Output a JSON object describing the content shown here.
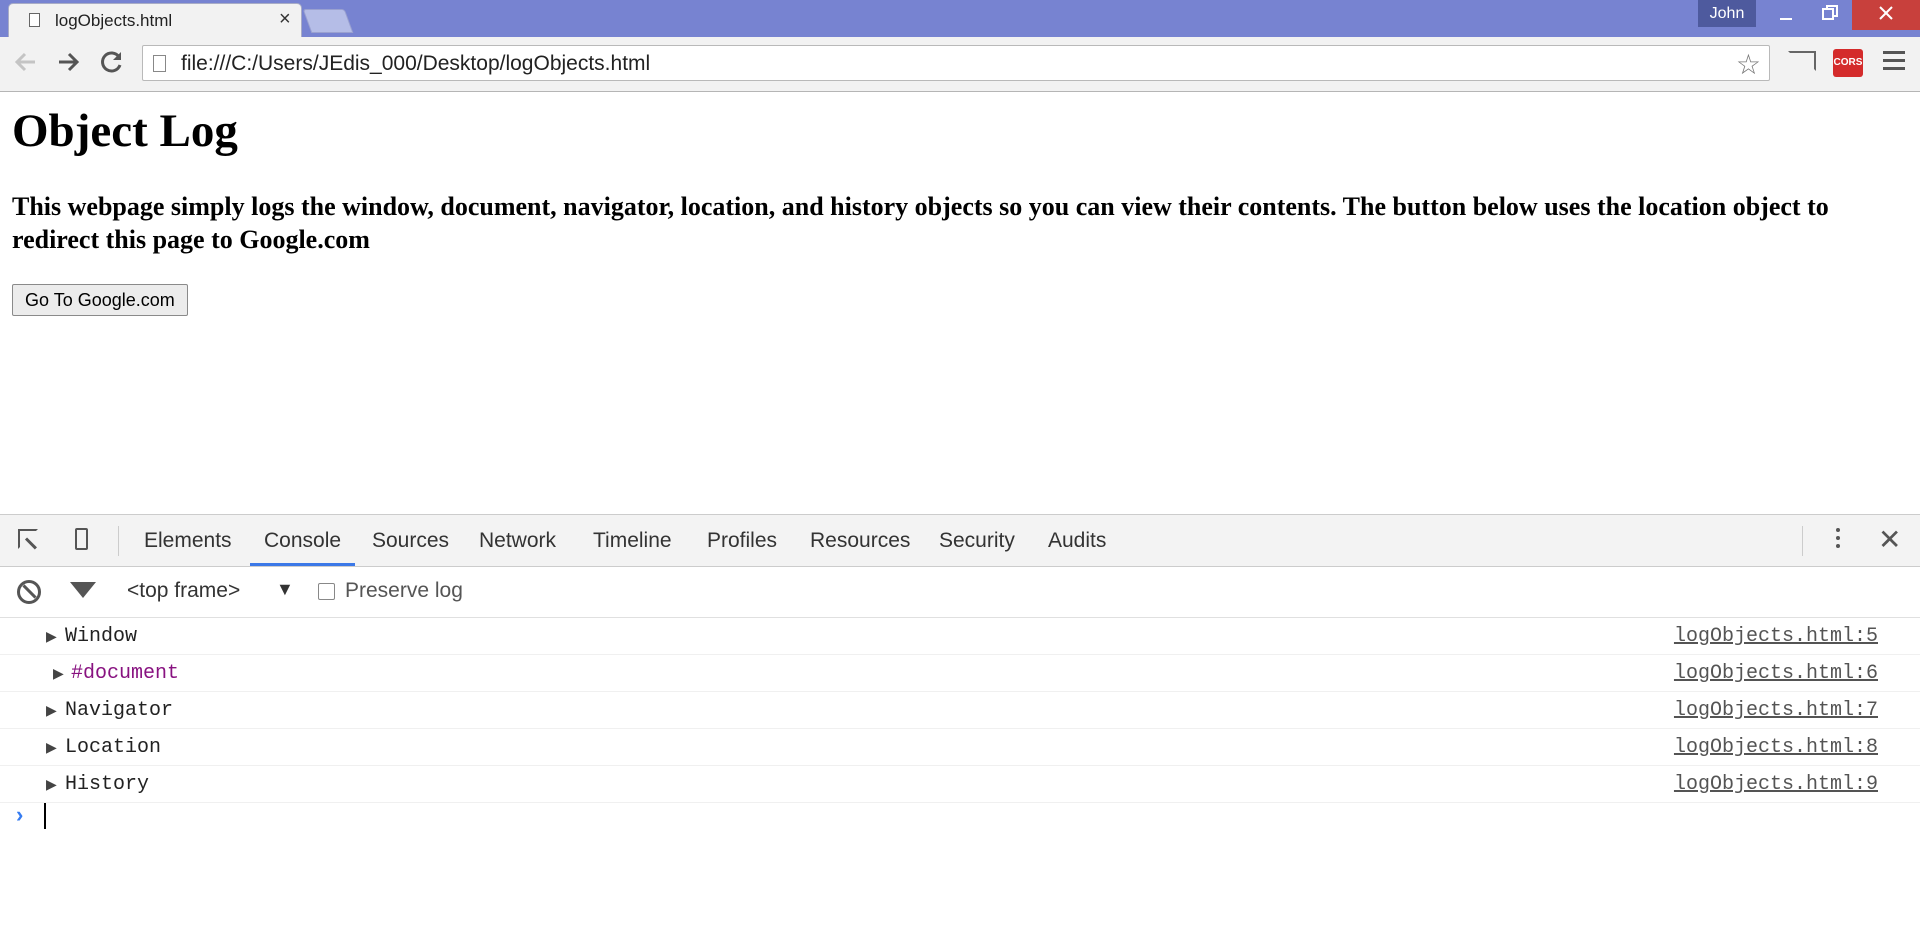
{
  "browser": {
    "tab_title": "logObjects.html",
    "tab_close": "×",
    "user_name": "John",
    "url": "file:///C:/Users/JEdis_000/Desktop/logObjects.html",
    "extension_label": "CORS",
    "accent_color": "#7783d1"
  },
  "page": {
    "heading": "Object Log",
    "description": "This webpage simply logs the window, document, navigator, location, and history objects so you can view their contents. The button below uses the location object to redirect this page to Google.com",
    "button_label": "Go To Google.com"
  },
  "devtools": {
    "tabs": [
      {
        "label": "Elements"
      },
      {
        "label": "Console"
      },
      {
        "label": "Sources"
      },
      {
        "label": "Network"
      },
      {
        "label": "Timeline"
      },
      {
        "label": "Profiles"
      },
      {
        "label": "Resources"
      },
      {
        "label": "Security"
      },
      {
        "label": "Audits"
      }
    ],
    "active_tab": "Console",
    "frame_selector": "<top frame>",
    "preserve_log_label": "Preserve log",
    "preserve_log_checked": false,
    "console_entries": [
      {
        "object": "Window",
        "source": "logObjects.html:5"
      },
      {
        "object": "#document",
        "source": "logObjects.html:6"
      },
      {
        "object": "Navigator",
        "source": "logObjects.html:7"
      },
      {
        "object": "Location",
        "source": "logObjects.html:8"
      },
      {
        "object": "History",
        "source": "logObjects.html:9"
      }
    ]
  }
}
